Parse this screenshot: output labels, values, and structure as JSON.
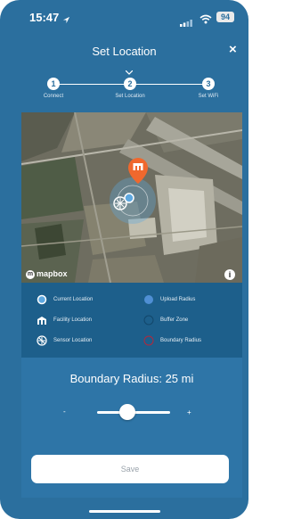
{
  "status_bar": {
    "time": "15:47",
    "battery": "94",
    "icons": [
      "location-arrow-icon",
      "signal-icon",
      "wifi-icon",
      "battery-icon"
    ]
  },
  "header": {
    "title": "Set Location",
    "close_label": "×"
  },
  "steps": [
    {
      "number": "1",
      "label": "Connect"
    },
    {
      "number": "2",
      "label": "Set Location"
    },
    {
      "number": "3",
      "label": "Set WiFi"
    }
  ],
  "map": {
    "attribution": "mapbox",
    "info_label": "i"
  },
  "legend": {
    "left": [
      {
        "label": "Current Location",
        "icon": "current-location-icon"
      },
      {
        "label": "Facility Location",
        "icon": "facility-icon"
      },
      {
        "label": "Sensor Location",
        "icon": "sensor-icon"
      }
    ],
    "right": [
      {
        "label": "Upload Radius",
        "icon": "upload-radius-icon"
      },
      {
        "label": "Buffer Zone",
        "icon": "buffer-zone-icon"
      },
      {
        "label": "Boundary Radius",
        "icon": "boundary-radius-icon"
      }
    ]
  },
  "radius": {
    "title": "Boundary Radius: 25 mi",
    "slider_position": 0.42,
    "min_label": "-",
    "max_label": "+"
  },
  "save_label": "Save",
  "colors": {
    "background": "#2b6f9e",
    "legend": "#1d5f8b",
    "panel": "#2e75a7",
    "facility_pin": "#f0682d",
    "current_location": "#5ea8e0",
    "boundary": "#b2283d"
  }
}
